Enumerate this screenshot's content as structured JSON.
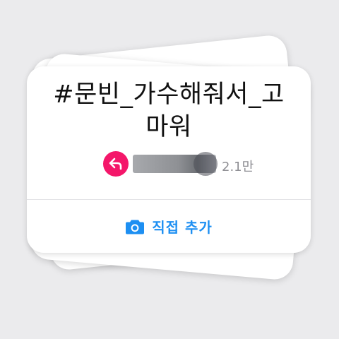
{
  "card": {
    "title_line1": "#문빈_가수해줘서_고",
    "title_line2": "마워",
    "response_count": "2.1만",
    "add_direct_label": "직접 추가"
  },
  "colors": {
    "background": "#ebebed",
    "reply_accent": "#f4176a",
    "action_blue": "#1d8ff2",
    "count_gray": "#8f8f94"
  },
  "icons": {
    "reply": "reply-arrow-icon",
    "camera": "camera-icon"
  }
}
